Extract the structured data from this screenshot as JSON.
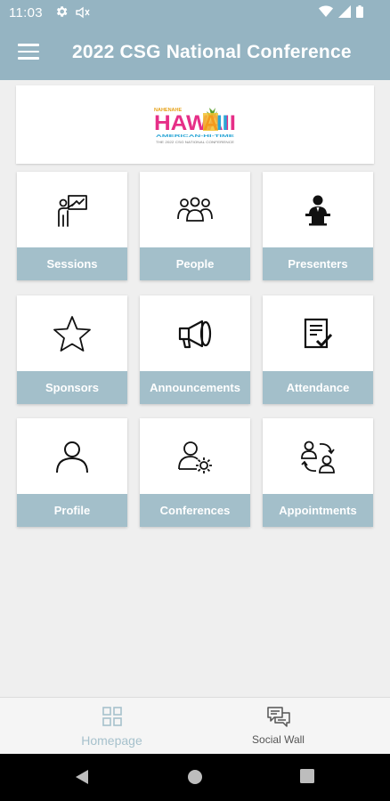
{
  "status": {
    "time": "11:03"
  },
  "appbar": {
    "title": "2022 CSG National Conference"
  },
  "banner": {
    "logo_top": "NAHENAHE",
    "logo_main": "HAWAII",
    "logo_bottom": "AMERICAN-HI-TIME",
    "logo_tagline": "THE 2022 CSG NATIONAL CONFERENCE"
  },
  "tiles": [
    {
      "label": "Sessions",
      "icon": "presentation-icon"
    },
    {
      "label": "People",
      "icon": "people-icon"
    },
    {
      "label": "Presenters",
      "icon": "podium-speaker-icon"
    },
    {
      "label": "Sponsors",
      "icon": "star-icon"
    },
    {
      "label": "Announcements",
      "icon": "megaphone-icon"
    },
    {
      "label": "Attendance",
      "icon": "checklist-icon"
    },
    {
      "label": "Profile",
      "icon": "user-icon"
    },
    {
      "label": "Conferences",
      "icon": "user-gear-icon"
    },
    {
      "label": "Appointments",
      "icon": "user-exchange-icon"
    }
  ],
  "bottom_nav": {
    "items": [
      {
        "label": "Homepage",
        "icon": "grid-icon",
        "active": true
      },
      {
        "label": "Social Wall",
        "icon": "chat-bubbles-icon",
        "active": false
      }
    ]
  },
  "colors": {
    "header": "#95b4c2",
    "tile_label": "#a3bfca",
    "active_nav": "#a6c1cc"
  }
}
